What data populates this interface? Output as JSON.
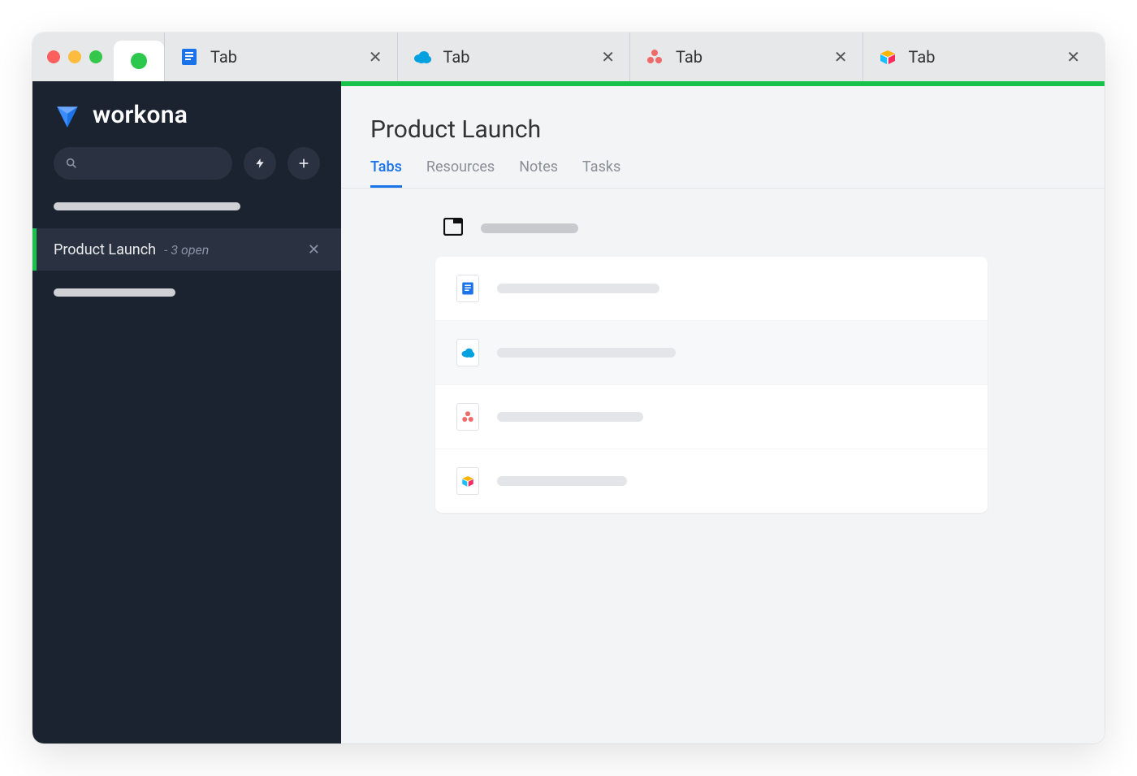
{
  "browser": {
    "tabs": [
      {
        "label": "Tab",
        "icon": "google-doc"
      },
      {
        "label": "Tab",
        "icon": "salesforce"
      },
      {
        "label": "Tab",
        "icon": "asana"
      },
      {
        "label": "Tab",
        "icon": "airtable"
      }
    ]
  },
  "sidebar": {
    "brand": "workona",
    "spaces": [
      {
        "title": "Product Launch",
        "subtitle": "- 3 open",
        "active": true
      }
    ]
  },
  "main": {
    "title": "Product Launch",
    "tabs": [
      {
        "label": "Tabs",
        "active": true
      },
      {
        "label": "Resources",
        "active": false
      },
      {
        "label": "Notes",
        "active": false
      },
      {
        "label": "Tasks",
        "active": false
      }
    ],
    "tab_items": [
      {
        "icon": "google-doc"
      },
      {
        "icon": "salesforce"
      },
      {
        "icon": "asana"
      },
      {
        "icon": "airtable"
      }
    ]
  }
}
